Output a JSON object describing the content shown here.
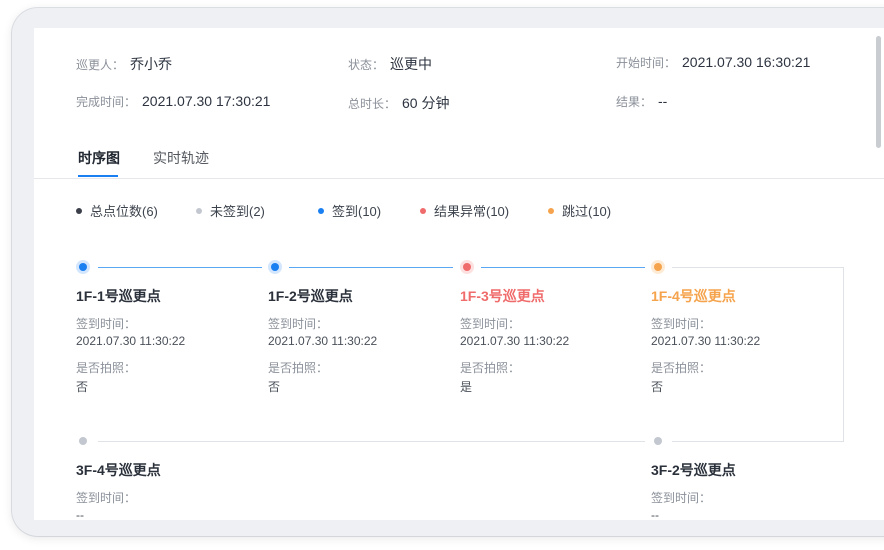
{
  "info": {
    "patroller": {
      "label": "巡更人：",
      "value": "乔小乔"
    },
    "status": {
      "label": "状态：",
      "value": "巡更中"
    },
    "start_time": {
      "label": "开始时间：",
      "value": "2021.07.30 16:30:21"
    },
    "finish_time": {
      "label": "完成时间：",
      "value": "2021.07.30 17:30:21"
    },
    "duration": {
      "label": "总时长：",
      "value": "60 分钟"
    },
    "result": {
      "label": "结果：",
      "value": "--"
    }
  },
  "tabs": [
    {
      "label": "时序图",
      "active": true
    },
    {
      "label": "实时轨迹",
      "active": false
    }
  ],
  "legend": [
    {
      "label": "总点位数(6)",
      "color": "#3b3f4a"
    },
    {
      "label": "未签到(2)",
      "color": "#c3c7cf"
    },
    {
      "label": "签到(10)",
      "color": "#1a7ff0"
    },
    {
      "label": "结果异常(10)",
      "color": "#f06b6b"
    },
    {
      "label": "跳过(10)",
      "color": "#f5a34c"
    }
  ],
  "points": [
    {
      "name": "1F-1号巡更点",
      "state": "signed",
      "sign_label": "签到时间：",
      "sign_time": "2021.07.30 11:30:22",
      "photo_label": "是否拍照：",
      "photo": "否"
    },
    {
      "name": "1F-2号巡更点",
      "state": "signed",
      "sign_label": "签到时间：",
      "sign_time": "2021.07.30 11:30:22",
      "photo_label": "是否拍照：",
      "photo": "否"
    },
    {
      "name": "1F-3号巡更点",
      "state": "abnormal",
      "sign_label": "签到时间：",
      "sign_time": "2021.07.30 11:30:22",
      "photo_label": "是否拍照：",
      "photo": "是"
    },
    {
      "name": "1F-4号巡更点",
      "state": "skipped",
      "sign_label": "签到时间：",
      "sign_time": "2021.07.30 11:30:22",
      "photo_label": "是否拍照：",
      "photo": "否"
    },
    {
      "name": "3F-4号巡更点",
      "state": "unsigned",
      "sign_label": "签到时间：",
      "sign_time": "--"
    },
    {
      "name": "3F-2号巡更点",
      "state": "unsigned",
      "sign_label": "签到时间：",
      "sign_time": "--"
    }
  ],
  "colors": {
    "signed": "#1a7ff0",
    "signed_halo": "#d3e6fd",
    "abnormal": "#f06b6b",
    "abnormal_halo": "#fde0e0",
    "skipped": "#f5a34c",
    "skipped_halo": "#fdebd6",
    "unsigned": "#c3c7cf",
    "line_active": "#5aa7f3",
    "line_inactive": "#dfe2e6"
  }
}
